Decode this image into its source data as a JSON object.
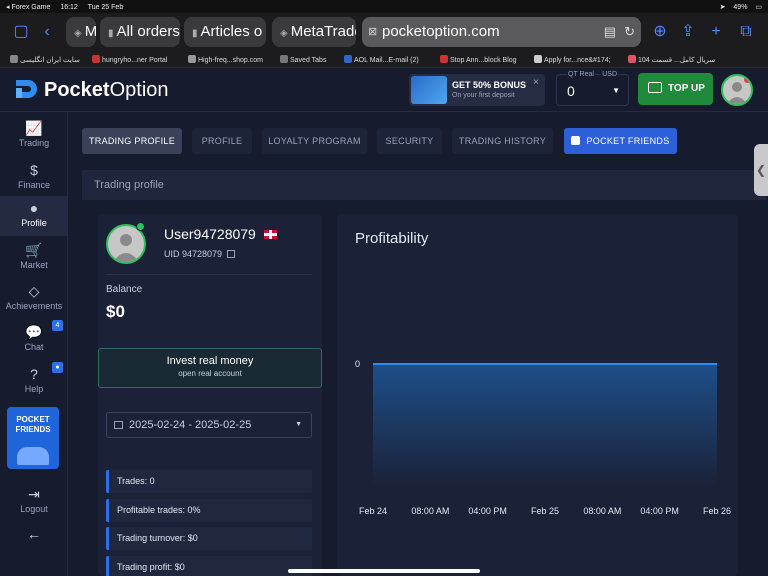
{
  "statusbar": {
    "carrier": "◂ Forex Game",
    "time": "16:12",
    "date": "Tue 25 Feb",
    "battery": "49%"
  },
  "browser": {
    "tabs": [
      "M",
      "All orders",
      "Articles o",
      "MetaTrade"
    ],
    "url": "pocketoption.com",
    "bookmarks": [
      "سایت ایران انگلیسی",
      "hungryho...ner Portal",
      "High-freq...shop.com",
      "Saved Tabs",
      "AOL Mail...E-mail (2)",
      "Stop Ann...block Blog",
      "Apply for...nce&#174;",
      "سریال کامل... قسمت 104"
    ]
  },
  "header": {
    "logo_bold": "Pocket",
    "logo_light": "Option",
    "bonus_title": "GET 50% BONUS",
    "bonus_sub": "On your first deposit",
    "account_label": "QT Real",
    "account_currency": "USD",
    "account_balance": "0",
    "topup_label": "TOP UP",
    "close_icon": "×"
  },
  "sidebar": {
    "items": [
      {
        "label": "Trading",
        "icon": "chart-icon"
      },
      {
        "label": "Finance",
        "icon": "dollar-icon"
      },
      {
        "label": "Profile",
        "icon": "user-icon"
      },
      {
        "label": "Market",
        "icon": "cart-icon"
      },
      {
        "label": "Achievements",
        "icon": "diamond-icon"
      },
      {
        "label": "Chat",
        "icon": "chat-icon",
        "badge": "4"
      },
      {
        "label": "Help",
        "icon": "help-icon"
      }
    ],
    "promo": "POCKET FRIENDS",
    "logout": "Logout"
  },
  "tabs": [
    "TRADING PROFILE",
    "PROFILE",
    "LOYALTY PROGRAM",
    "SECURITY",
    "TRADING HISTORY",
    "POCKET FRIENDS"
  ],
  "section_title": "Trading profile",
  "profile": {
    "username": "User94728079",
    "uid": "UID 94728079",
    "balance_label": "Balance",
    "balance": "$0",
    "invest_title": "Invest real money",
    "invest_sub": "open real account",
    "date_range": "2025-02-24 - 2025-02-25",
    "stats": [
      "Trades: 0",
      "Profitable trades: 0%",
      "Trading turnover: $0",
      "Trading profit: $0"
    ]
  },
  "chart_data": {
    "type": "area",
    "title": "Profitability",
    "x": [
      "Feb 24",
      "08:00 AM",
      "04:00 PM",
      "Feb 25",
      "08:00 AM",
      "04:00 PM",
      "Feb 26"
    ],
    "yticks": [
      "0"
    ],
    "series": [
      {
        "values": [
          0,
          0,
          0,
          0,
          0,
          0,
          0
        ]
      }
    ],
    "colors": {
      "line": "#2d8cf0",
      "fill_top": "#1d4f8a",
      "fill_bottom": "#1b2136"
    },
    "grid": false
  }
}
